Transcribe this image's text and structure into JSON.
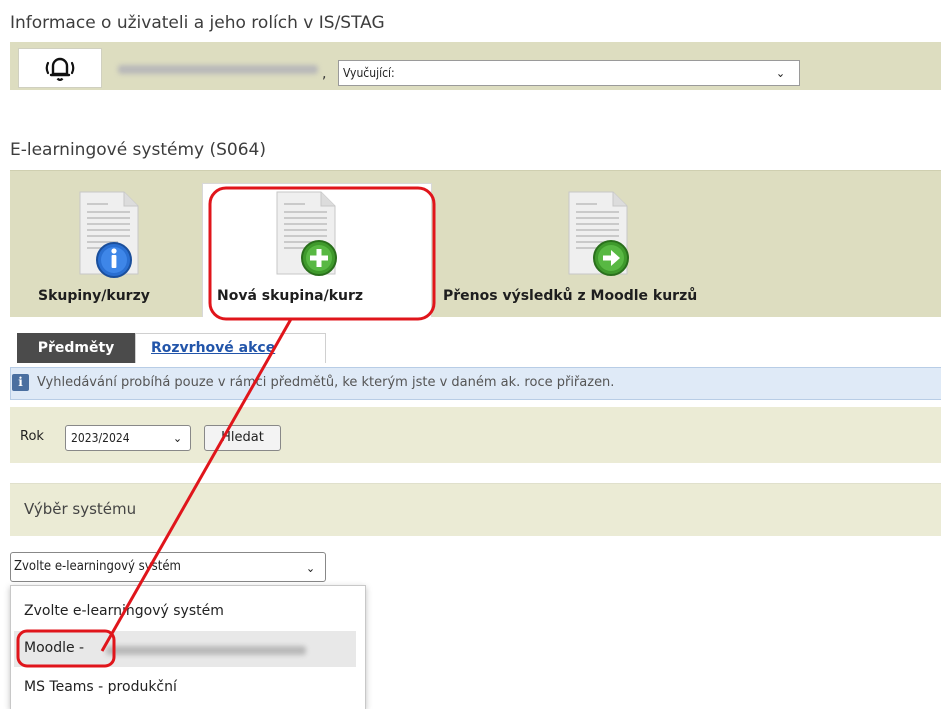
{
  "header": {
    "title": "Informace o uživateli a jeho rolích v IS/STAG"
  },
  "user": {
    "name_separator": ",",
    "role_select": "Vyučující:"
  },
  "section": {
    "title": "E-learningové systémy (S064)"
  },
  "modules": [
    {
      "label": "Skupiny/kurzy",
      "icon": "info-icon"
    },
    {
      "label": "Nová skupina/kurz",
      "icon": "plus-icon"
    },
    {
      "label": "Přenos výsledků z Moodle kurzů",
      "icon": "arrow-right-icon"
    }
  ],
  "tabs": [
    {
      "label": "Předměty"
    },
    {
      "label": "Rozvrhové akce"
    }
  ],
  "info": {
    "text": "Vyhledávání probíhá pouze v rámci předmětů, ke kterým jste v daném ak. roce přiřazen."
  },
  "filter": {
    "rok_label": "Rok",
    "rok_value": "2023/2024",
    "search_button": "Hledat"
  },
  "system": {
    "label": "Výběr systému",
    "select_value": "Zvolte e-learningový systém",
    "options": [
      "Zvolte e-learningový systém",
      "Moodle -",
      "MS Teams - produkční"
    ]
  },
  "colors": {
    "highlight": "#e0151b",
    "panel": "#ddddc0",
    "tab_active": "#4b4b4b",
    "link": "#2255aa"
  }
}
